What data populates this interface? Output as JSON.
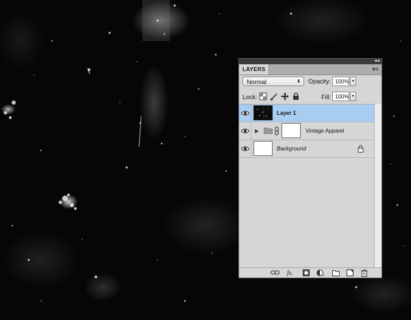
{
  "panel": {
    "tab_label": "LAYERS",
    "menu_icon": "panel-menu-icon",
    "collapse_icon": "collapse-arrows-icon",
    "blend_mode": "Normal",
    "opacity_label": "Opacity:",
    "opacity_value": "100%",
    "lock_label": "Lock:",
    "fill_label": "Fill:",
    "fill_value": "100%",
    "selection_color": "#a8cdf3"
  },
  "layers": [
    {
      "name": "Layer 1",
      "visible": true,
      "selected": true,
      "type": "raster",
      "italic": false
    },
    {
      "name": "Vintage Apparel",
      "visible": true,
      "selected": false,
      "type": "group",
      "italic": false
    },
    {
      "name": "Background",
      "visible": true,
      "selected": false,
      "type": "background",
      "italic": true,
      "locked": true
    }
  ],
  "footer_icons": [
    "link-layers-icon",
    "fx-icon",
    "add-mask-icon",
    "adjustment-layer-icon",
    "new-group-icon",
    "new-layer-icon",
    "trash-icon"
  ]
}
